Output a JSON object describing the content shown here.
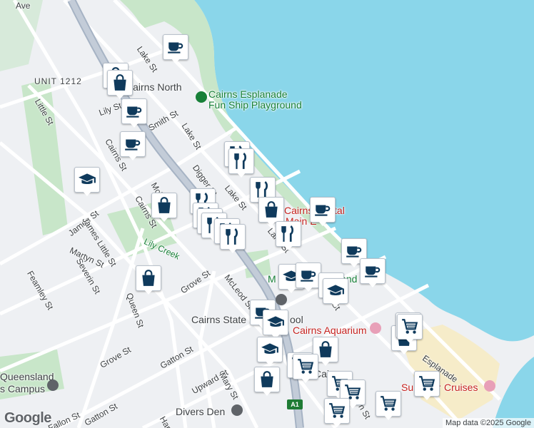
{
  "colors": {
    "water": "#8ad6ea",
    "park": "#c8e6c9",
    "land": "#eef0f3",
    "highway": "#a6b3c4",
    "marker_icon": "#0f3a5c",
    "road": "#ffffff"
  },
  "labels": {
    "ave": "Ave",
    "unit": "UNIT 1212",
    "cairns_north": "Cairns North",
    "lake_st_top": "Lake St",
    "little_st": "Little St",
    "lily_st": "Lily St",
    "smith_st": "Smith St",
    "lake_st_mid": "Lake St",
    "cairns_st_a": "Cairns St",
    "digger_st": "Digger St",
    "lake_st_c": "Lake St",
    "lake_st_d": "Lake St",
    "cairns_st_b": "Cairns St",
    "mcl": "Mcl",
    "james_st": "James St",
    "james_little_st": "James Little St",
    "lily_creek": "Lily Creek",
    "martyn_st": "Martyn St",
    "severin_st": "Severin St",
    "feamley_st": "Feamley St",
    "grove_st_a": "Grove St",
    "mcleod_st": "McLeod St",
    "queen_st": "Queen St",
    "grove_st_b": "Grove St",
    "gatton_st_a": "Gatton St",
    "upward_st": "Upward St",
    "mary_st": "Mary St",
    "gatton_st_b": "Gatton St",
    "fallon_st": "Fallon St",
    "har": "Har",
    "queensland": "Queensland",
    "campus": "s Campus",
    "esplanade": "Esplanade",
    "lake_st_e": "Lake St",
    "m_st": "Mc",
    "n_st": "n St"
  },
  "pois": {
    "esplanade_playground_1": "Cairns Esplanade",
    "esplanade_playground_2": "Fun Ship Playground",
    "cairns_central_1": "Cairns Cental",
    "cairns_central_2": "Main E",
    "mcleod": "M",
    "land": "land",
    "cairns_state": "Cairns State",
    "school": "ool",
    "aquarium": "Cairns Aquarium",
    "sunlover": "Sunlover",
    "cruises": "Cruises",
    "divers_den": "Divers Den",
    "cai": "Cai"
  },
  "markers": [
    {
      "icon": "cafe",
      "label": "cafe"
    },
    {
      "icon": "bag",
      "label": "shopping"
    },
    {
      "icon": "bag",
      "label": "shopping"
    },
    {
      "icon": "cafe",
      "label": "cafe"
    },
    {
      "icon": "cafe",
      "label": "cafe"
    },
    {
      "icon": "school",
      "label": "school"
    },
    {
      "icon": "bag",
      "label": "shopping"
    },
    {
      "icon": "restaurant",
      "label": "restaurant"
    },
    {
      "icon": "restaurant",
      "label": "restaurant"
    },
    {
      "icon": "restaurant",
      "label": "restaurant"
    },
    {
      "icon": "restaurant",
      "label": "restaurant"
    },
    {
      "icon": "restaurant",
      "label": "restaurant"
    },
    {
      "icon": "restaurant",
      "label": "restaurant"
    },
    {
      "icon": "restaurant",
      "label": "restaurant"
    },
    {
      "icon": "restaurant",
      "label": "restaurant"
    },
    {
      "icon": "restaurant",
      "label": "restaurant"
    },
    {
      "icon": "bag",
      "label": "shopping"
    },
    {
      "icon": "cafe",
      "label": "cafe"
    },
    {
      "icon": "restaurant",
      "label": "restaurant"
    },
    {
      "icon": "cafe",
      "label": "cafe"
    },
    {
      "icon": "cafe",
      "label": "cafe"
    },
    {
      "icon": "school",
      "label": "school"
    },
    {
      "icon": "cafe",
      "label": "cafe"
    },
    {
      "icon": "cafe",
      "label": "cafe"
    },
    {
      "icon": "school",
      "label": "school"
    },
    {
      "icon": "bag",
      "label": "shopping"
    },
    {
      "icon": "cafe",
      "label": "cafe"
    },
    {
      "icon": "school",
      "label": "school"
    },
    {
      "icon": "school",
      "label": "school"
    },
    {
      "icon": "bag",
      "label": "shopping"
    },
    {
      "icon": "cart",
      "label": "supermarket"
    },
    {
      "icon": "bag",
      "label": "shopping"
    },
    {
      "icon": "cart",
      "label": "supermarket"
    },
    {
      "icon": "bag",
      "label": "shopping"
    },
    {
      "icon": "cart",
      "label": "supermarket"
    },
    {
      "icon": "cart",
      "label": "supermarket"
    },
    {
      "icon": "cart",
      "label": "supermarket"
    },
    {
      "icon": "cart",
      "label": "supermarket"
    },
    {
      "icon": "cart",
      "label": "supermarket"
    },
    {
      "icon": "cart",
      "label": "supermarket"
    },
    {
      "icon": "cart",
      "label": "supermarket"
    }
  ],
  "route": "A1",
  "attribution": "Map data ©2025 Google",
  "logo": "Google"
}
